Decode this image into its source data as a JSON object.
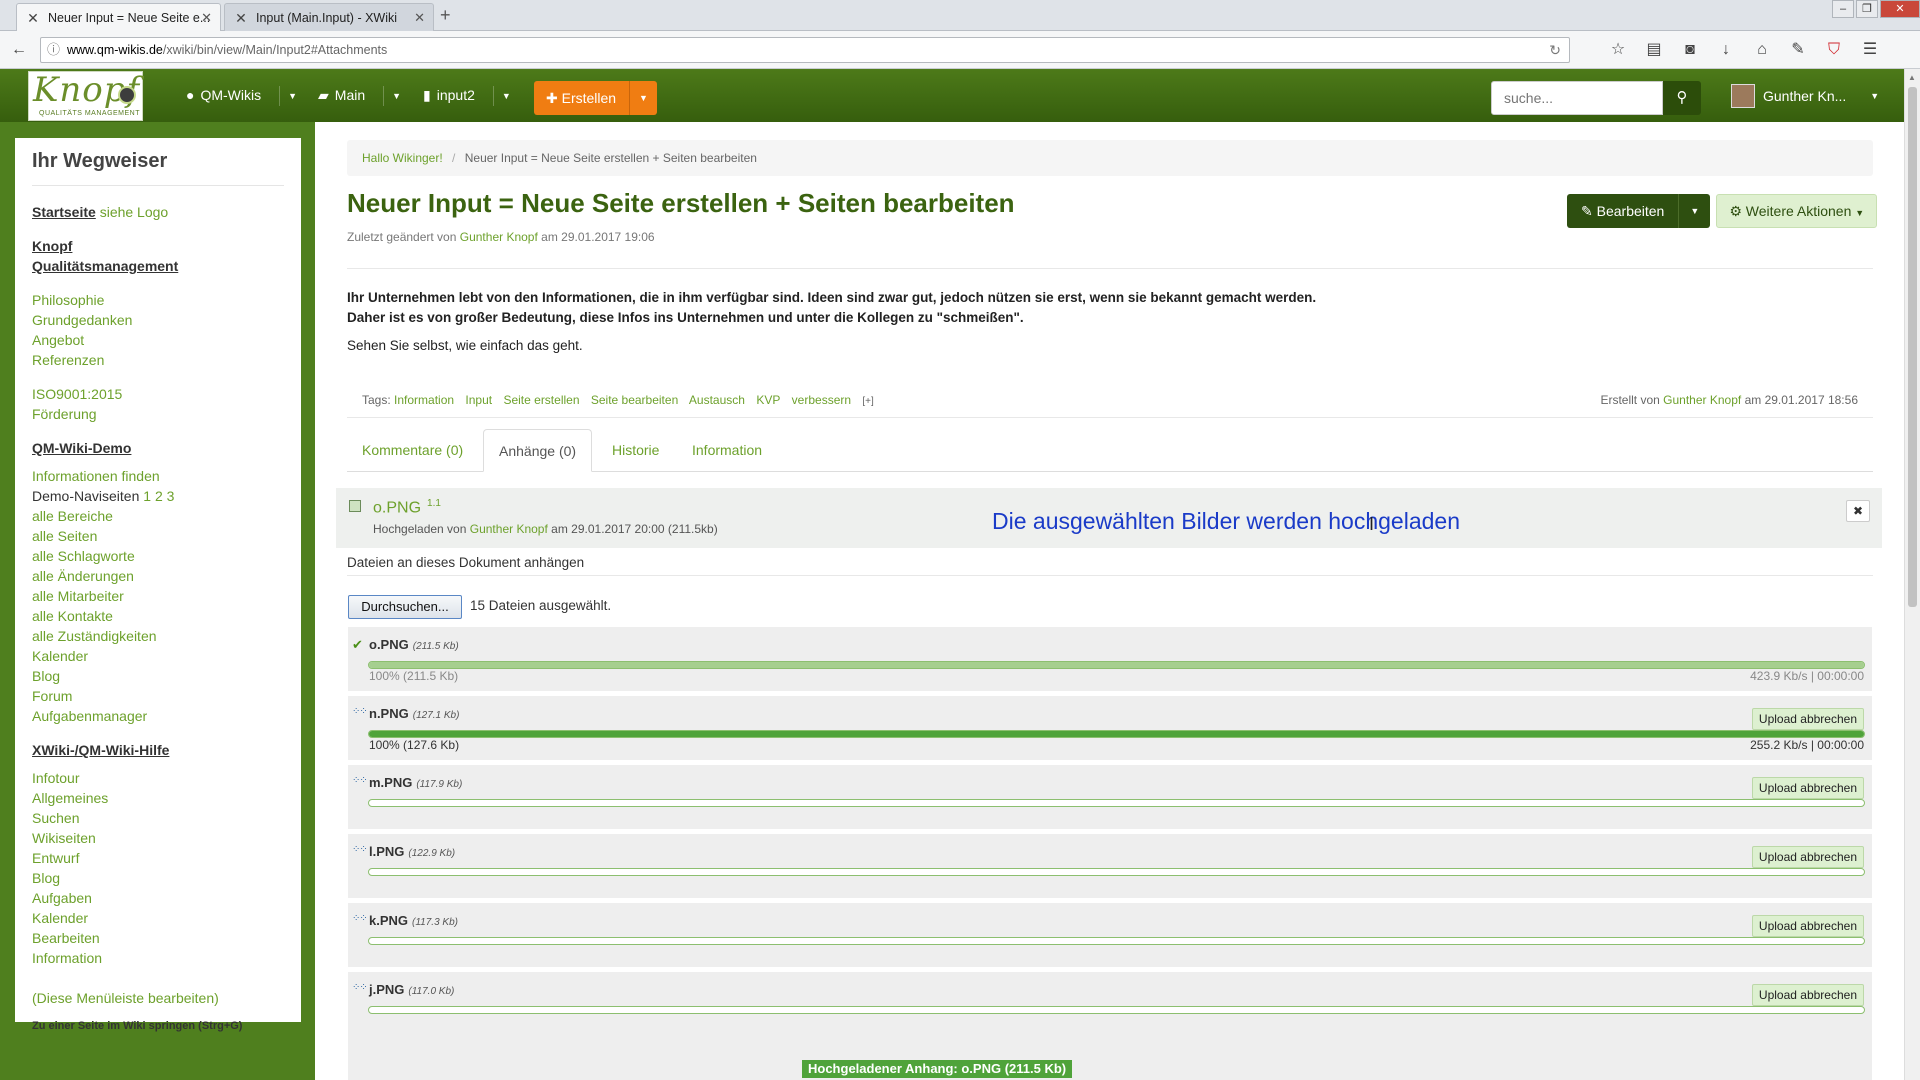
{
  "browser": {
    "tabs": [
      {
        "title": "Neuer Input = Neue Seite e..."
      },
      {
        "title": "Input (Main.Input) - XWiki"
      }
    ],
    "url_host": "www.qm-wikis.de",
    "url_path": "/xwiki/bin/view/Main/Input2#Attachments"
  },
  "topbar": {
    "logo_text": "Knopf",
    "logo_sub": "QUALITÄTS MANAGEMENT",
    "menu": [
      {
        "label": "QM-Wikis",
        "icon": "globe-icon"
      },
      {
        "label": "Main",
        "icon": "folder-icon"
      },
      {
        "label": "input2",
        "icon": "page-icon"
      }
    ],
    "create_label": "Erstellen",
    "search_placeholder": "suche...",
    "user_name": "Gunther Kn..."
  },
  "sidebar": {
    "title": "Ihr Wegweiser",
    "start_link": "Startseite",
    "start_suffix": "siehe Logo",
    "company_line1": "Knopf",
    "company_line2": "Qualitätsmanagement",
    "group1": [
      "Philosophie",
      "Grundgedanken",
      "Angebot",
      "Referenzen"
    ],
    "group2": [
      "ISO9001:2015",
      "Förderung"
    ],
    "demo_head": "QM-Wiki-Demo",
    "demo_first": "Informationen finden",
    "demo_navi_label": "Demo-Naviseiten",
    "demo_navi_pages": "1 2 3",
    "demo_items": [
      "alle Bereiche",
      "alle Seiten",
      "alle Schlagworte",
      "alle Änderungen",
      "alle Mitarbeiter",
      "alle Kontakte",
      "alle Zuständigkeiten",
      "Kalender",
      "Blog",
      "Forum",
      "Aufgabenmanager"
    ],
    "help_head": "XWiki-/QM-Wiki-Hilfe",
    "help_items": [
      "Infotour",
      "Allgemeines",
      "Suchen",
      "Wikiseiten",
      "Entwurf",
      "Blog",
      "Aufgaben",
      "Kalender",
      "Bearbeiten",
      "Information"
    ],
    "edit_menu": "(Diese Menüleiste bearbeiten)",
    "jump": "Zu einer Seite im Wiki springen (Strg+G)"
  },
  "content": {
    "breadcrumb": [
      "Hallo Wikinger!",
      "Neuer Input = Neue Seite erstellen + Seiten bearbeiten"
    ],
    "title": "Neuer Input = Neue Seite erstellen + Seiten bearbeiten",
    "meta_prefix": "Zuletzt geändert von",
    "meta_author": "Gunther Knopf",
    "meta_suffix": "am 29.01.2017 19:06",
    "edit_label": "Bearbeiten",
    "more_label": "Weitere Aktionen",
    "intro_line1": "Ihr Unternehmen lebt von den Informationen, die in ihm verfügbar sind. Ideen sind zwar gut, jedoch nützen sie erst, wenn sie bekannt gemacht werden.",
    "intro_line2": "Daher ist es von großer Bedeutung, diese Infos ins Unternehmen und unter die Kollegen zu \"schmeißen\".",
    "intro_line3": "Sehen Sie selbst, wie einfach das geht.",
    "tags_label": "Tags:",
    "tags": [
      "Information",
      "Input",
      "Seite erstellen",
      "Seite bearbeiten",
      "Austausch",
      "KVP",
      "verbessern"
    ],
    "tags_plus": "[+]",
    "created_prefix": "Erstellt von",
    "created_author": "Gunther Knopf",
    "created_suffix": "am 29.01.2017 18:56",
    "tabs": [
      "Kommentare (0)",
      "Anhänge (0)",
      "Historie",
      "Information"
    ]
  },
  "attachment": {
    "name": "o.PNG",
    "version": "1.1",
    "meta_prefix": "Hochgeladen von",
    "meta_author": "Gunther Knopf",
    "meta_suffix": "am 29.01.2017 20:00 (211.5kb)",
    "close_symbol": "✖",
    "caption": "Die ausgewählten Bilder werden hochgeladen"
  },
  "upload": {
    "attach_label": "Dateien an dieses Dokument anhängen",
    "browse_label": "Durchsuchen...",
    "selected_label": "15 Dateien ausgewählt.",
    "cancel_label": "Upload abbrechen",
    "items": [
      {
        "name": "o.PNG",
        "size": "(211.5 Kb)",
        "progress": 1.0,
        "pct_text": "100%  (211.5 Kb)",
        "speed_text": "423.9 Kb/s | 00:00:00",
        "status": "done"
      },
      {
        "name": "n.PNG",
        "size": "(127.1 Kb)",
        "progress": 1.0,
        "pct_text": "100%  (127.6 Kb)",
        "speed_text": "255.2 Kb/s | 00:00:00",
        "status": "uploading"
      },
      {
        "name": "m.PNG",
        "size": "(117.9 Kb)",
        "progress": 0,
        "status": "waiting"
      },
      {
        "name": "l.PNG",
        "size": "(122.9 Kb)",
        "progress": 0,
        "status": "waiting"
      },
      {
        "name": "k.PNG",
        "size": "(117.3 Kb)",
        "progress": 0,
        "status": "waiting"
      },
      {
        "name": "j.PNG",
        "size": "(117.0 Kb)",
        "progress": 0,
        "status": "waiting"
      }
    ],
    "toast": "Hochgeladener Anhang: o.PNG (211.5 Kb)"
  },
  "colors": {
    "brand_green": "#4f7f1e",
    "link_green": "#6da12c",
    "create_orange": "#f07d12"
  }
}
